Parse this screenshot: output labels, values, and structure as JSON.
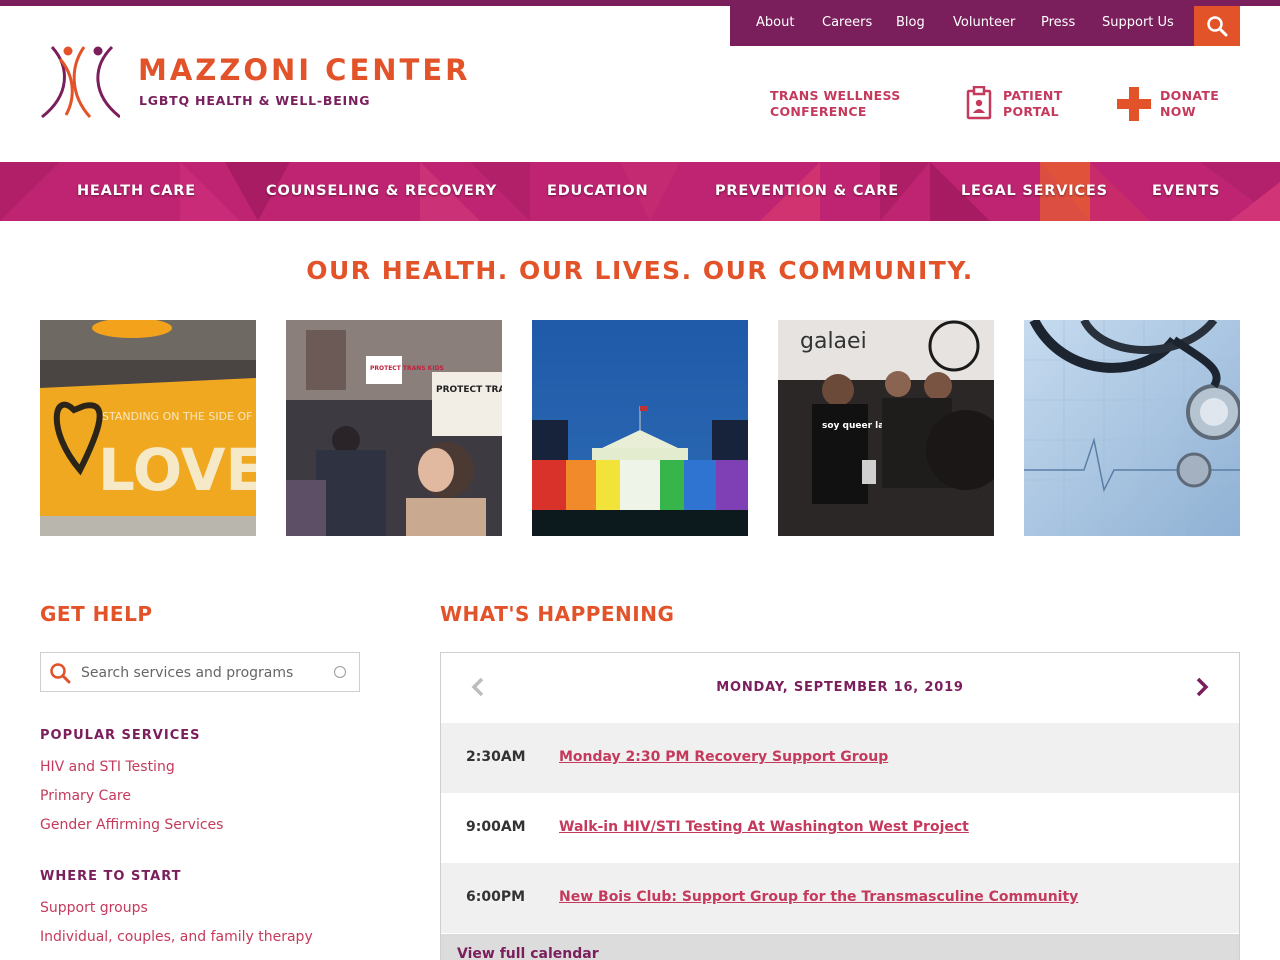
{
  "utility_nav": {
    "links": [
      "About",
      "Careers",
      "Blog",
      "Volunteer",
      "Press",
      "Support Us"
    ]
  },
  "brand": {
    "name": "MAZZONI CENTER",
    "tagline": "LGBTQ HEALTH & WELL-BEING"
  },
  "quick_links": [
    {
      "line1": "TRANS WELLNESS",
      "line2": "CONFERENCE"
    },
    {
      "line1": "PATIENT",
      "line2": "PORTAL"
    },
    {
      "line1": "DONATE",
      "line2": "NOW"
    }
  ],
  "main_nav": [
    "HEALTH CARE",
    "COUNSELING & RECOVERY",
    "EDUCATION",
    "PREVENTION & CARE",
    "LEGAL SERVICES",
    "EVENTS"
  ],
  "hero": {
    "headline": "OUR HEALTH. OUR LIVES. OUR COMMUNITY.",
    "photos": [
      {
        "banner_text": "STANDING ON THE SIDE OF",
        "big_text": "LOVE"
      },
      {
        "sign1": "PROTECT TRANS KIDS",
        "sign2": "PROTECT TRANS LIVES"
      },
      {},
      {
        "sign": "galaei",
        "shirt": "soy queer latino"
      },
      {}
    ]
  },
  "get_help": {
    "title": "GET HELP",
    "search_placeholder": "Search services and programs",
    "popular_heading": "POPULAR SERVICES",
    "popular": [
      "HIV and STI Testing",
      "Primary Care",
      "Gender Affirming Services"
    ],
    "start_heading": "WHERE TO START",
    "start": [
      "Support groups",
      "Individual, couples, and family therapy"
    ]
  },
  "whats_happening": {
    "title": "WHAT'S HAPPENING",
    "date": "MONDAY, SEPTEMBER 16, 2019",
    "events": [
      {
        "time": "2:30AM",
        "title": "Monday 2:30 PM Recovery Support Group"
      },
      {
        "time": "9:00AM",
        "title": "Walk-in HIV/STI Testing At Washington West Project"
      },
      {
        "time": "6:00PM",
        "title": "New Bois Club: Support Group for the Transmasculine Community"
      }
    ],
    "footer_link": "View full calendar"
  },
  "colors": {
    "brand_purple": "#7a1e5c",
    "brand_orange": "#e2532a",
    "link_pink": "#c53a5c",
    "nav_magenta": "#bf2472"
  },
  "icons": [
    "search-icon",
    "clipboard-icon",
    "plus-icon",
    "chevron-left-icon",
    "chevron-right-icon",
    "loading-icon"
  ]
}
